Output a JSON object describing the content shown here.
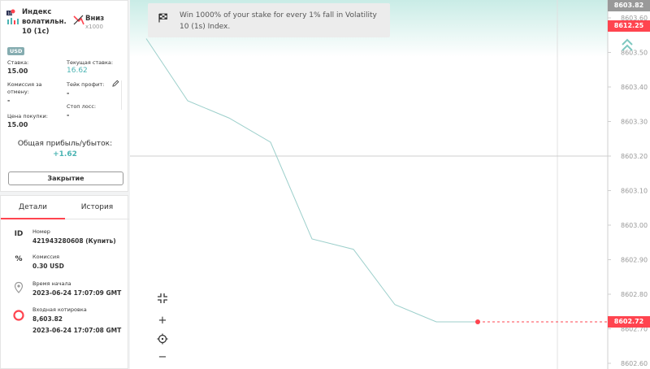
{
  "contract": {
    "asset_name": "Индекс волатильн. 10 (1с)",
    "direction_label": "Вниз",
    "multiplier": "x1000",
    "currency_badge": "USD",
    "stake_label": "Ставка:",
    "stake_value": "15.00",
    "current_stake_label": "Текущая ставка:",
    "current_stake_value": "16.62",
    "cancel_fee_label": "Комиссия за отмену:",
    "cancel_fee_value": "-",
    "take_profit_label": "Тейк профит:",
    "take_profit_value": "-",
    "stop_loss_label": "Стоп лосс:",
    "stop_loss_value": "-",
    "buy_price_label": "Цена покупки:",
    "buy_price_value": "15.00",
    "total_pl_label": "Общая прибыль/убыток:",
    "total_pl_value": "+1.62",
    "close_button": "Закрытие"
  },
  "details": {
    "tabs": [
      {
        "label": "Детали"
      },
      {
        "label": "История"
      }
    ],
    "rows": [
      {
        "icon_text": "ID",
        "icon": "id-icon",
        "label": "Номер",
        "values": [
          "421943280608 (Купить)"
        ]
      },
      {
        "icon_text": "%",
        "icon": "percent-icon",
        "label": "Комиссия",
        "values": [
          "0.30 USD"
        ]
      },
      {
        "icon_text": "",
        "icon": "pin-icon",
        "label": "Время начала",
        "values": [
          "2023-06-24 17:07:09 GMT"
        ]
      },
      {
        "icon_text": "",
        "icon": "circle-icon",
        "label": "Входная котировка",
        "values": [
          "8,603.82",
          "2023-06-24 17:07:08 GMT"
        ]
      }
    ]
  },
  "banner": {
    "text": "Win 1000% of your stake for every 1% fall in Volatility 10 (1s) Index."
  },
  "chart_data": {
    "type": "line",
    "y_ticks": [
      "8603.60",
      "8603.50",
      "8603.40",
      "8603.30",
      "8603.20",
      "8603.10",
      "8603.00",
      "8602.90",
      "8602.80",
      "8602.70",
      "8602.60"
    ],
    "ylim": [
      8602.6,
      8603.64
    ],
    "series": [
      {
        "values": [
          8603.54,
          8603.36,
          8603.31,
          8603.24,
          8602.96,
          8602.93,
          8602.77,
          8602.72,
          8602.72
        ]
      }
    ],
    "current_price": "8602.72",
    "top_price": "8603.82",
    "barrier_price": "8612.25",
    "barrier_level": 8603.2,
    "colors": {
      "line": "#9ccfcb",
      "current": "#ff444f",
      "barrier": "#ff444f",
      "top": "#999999"
    }
  },
  "controls": {
    "zoom_fit": "⇲",
    "zoom_in": "+",
    "zoom_out": "−"
  }
}
